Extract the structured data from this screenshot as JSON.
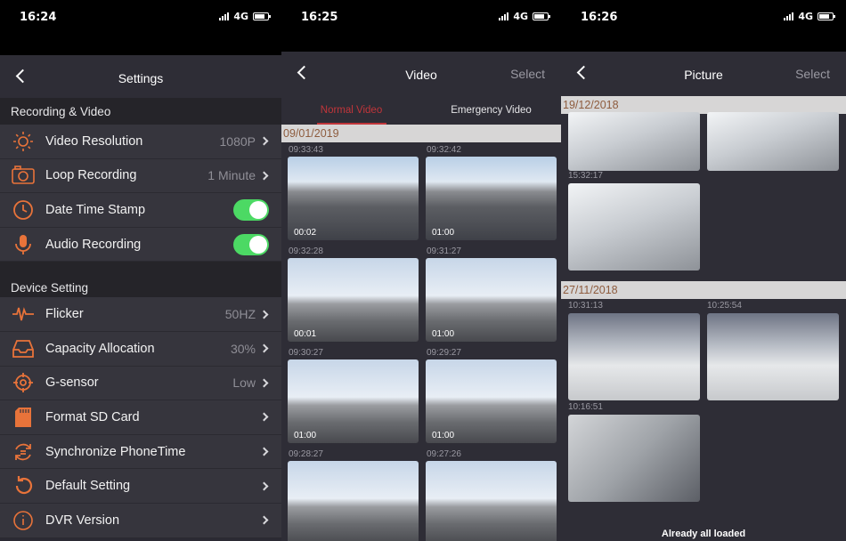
{
  "left": {
    "status": {
      "time": "16:24",
      "network": "4G"
    },
    "nav": {
      "title": "Settings"
    },
    "sections": [
      {
        "title": "Recording & Video",
        "rows": [
          {
            "label": "Video Resolution",
            "value": "1080P",
            "type": "chevron",
            "icon": "brightness-icon"
          },
          {
            "label": "Loop Recording",
            "value": "1 Minute",
            "type": "chevron",
            "icon": "camera-icon"
          },
          {
            "label": "Date Time Stamp",
            "value": "",
            "type": "toggle",
            "icon": "clock-icon"
          },
          {
            "label": "Audio Recording",
            "value": "",
            "type": "toggle",
            "icon": "microphone-icon"
          }
        ]
      },
      {
        "title": "Device Setting",
        "rows": [
          {
            "label": "Flicker",
            "value": "50HZ",
            "type": "chevron",
            "icon": "waveform-icon"
          },
          {
            "label": "Capacity Allocation",
            "value": "30%",
            "type": "chevron",
            "icon": "tray-icon"
          },
          {
            "label": "G-sensor",
            "value": "Low",
            "type": "chevron",
            "icon": "crosshair-icon"
          },
          {
            "label": "Format SD Card",
            "value": "",
            "type": "chevron",
            "icon": "sd-card-icon"
          },
          {
            "label": "Synchronize PhoneTime",
            "value": "",
            "type": "chevron",
            "icon": "sync-icon"
          },
          {
            "label": "Default Setting",
            "value": "",
            "type": "chevron",
            "icon": "reset-icon"
          },
          {
            "label": "DVR Version",
            "value": "",
            "type": "chevron",
            "icon": "info-icon"
          }
        ]
      }
    ]
  },
  "middle": {
    "status": {
      "time": "16:25",
      "network": "4G"
    },
    "nav": {
      "title": "Video",
      "select": "Select"
    },
    "tabs": [
      "Normal Video",
      "Emergency Video"
    ],
    "date": "09/01/2019",
    "videos": [
      {
        "time": "09:33:43",
        "duration": "00:02"
      },
      {
        "time": "09:32:42",
        "duration": "01:00"
      },
      {
        "time": "09:32:28",
        "duration": "00:01"
      },
      {
        "time": "09:31:27",
        "duration": "01:00"
      },
      {
        "time": "09:30:27",
        "duration": "01:00"
      },
      {
        "time": "09:29:27",
        "duration": "01:00"
      },
      {
        "time": "09:28:27",
        "duration": ""
      },
      {
        "time": "09:27:26",
        "duration": ""
      }
    ]
  },
  "right": {
    "status": {
      "time": "16:26",
      "network": "4G"
    },
    "nav": {
      "title": "Picture",
      "select": "Select"
    },
    "groups": [
      {
        "date": "19/12/2018",
        "times": [
          "",
          "",
          "15:32:17"
        ]
      },
      {
        "date": "27/11/2018",
        "times": [
          "10:31:13",
          "10:25:54",
          "10:16:51"
        ]
      }
    ],
    "footer": "Already all loaded"
  }
}
